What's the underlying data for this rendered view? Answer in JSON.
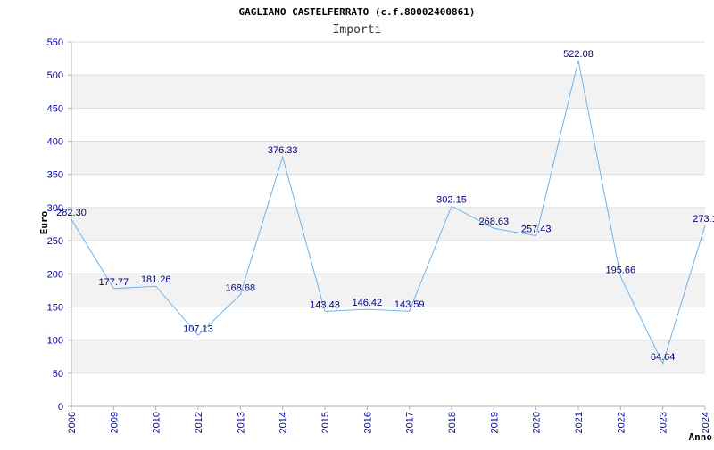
{
  "chart_data": {
    "type": "line",
    "title": "GAGLIANO CASTELFERRATO (c.f.80002400861)",
    "subtitle": "Importi",
    "xlabel": "Anno",
    "ylabel": "Euro",
    "ylim": [
      0,
      550
    ],
    "yticks": [
      0,
      50,
      100,
      150,
      200,
      250,
      300,
      350,
      400,
      450,
      500,
      550
    ],
    "grid": true,
    "legend": "none",
    "x": [
      "2006",
      "2009",
      "2010",
      "2012",
      "2013",
      "2014",
      "2015",
      "2016",
      "2017",
      "2018",
      "2019",
      "2020",
      "2021",
      "2022",
      "2023",
      "2024"
    ],
    "series": [
      {
        "values": [
          282.3,
          177.77,
          181.26,
          107.13,
          168.68,
          376.33,
          143.43,
          146.42,
          143.59,
          302.15,
          268.63,
          257.43,
          522.08,
          195.66,
          64.64,
          273.1
        ],
        "labels": [
          "282.30",
          "177.77",
          "181.26",
          "107.13",
          "168.68",
          "376.33",
          "143.43",
          "146.42",
          "143.59",
          "302.15",
          "268.63",
          "257.43",
          "522.08",
          "195.66",
          "64.64",
          "273.1"
        ]
      }
    ],
    "colors": {
      "line": "#6fb3ea",
      "band": "#f2f2f2",
      "gridline": "#dddddd",
      "axis": "#b0b0b0",
      "tick_text": "#0000aa",
      "label_text": "#000080"
    }
  }
}
